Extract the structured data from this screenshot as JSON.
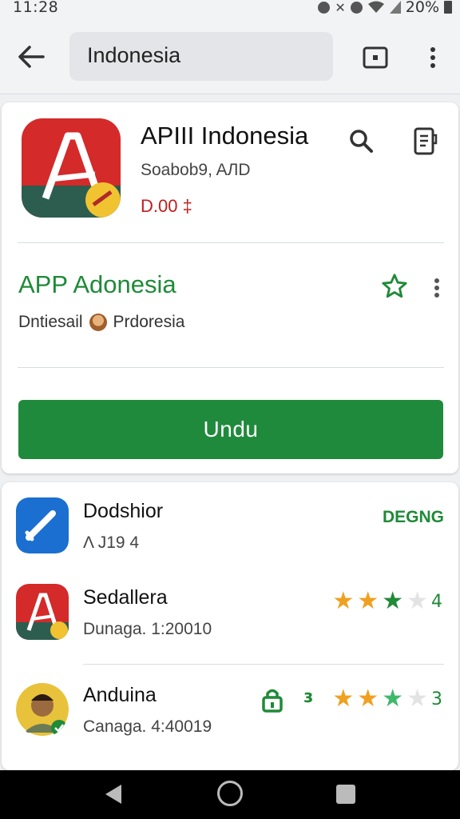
{
  "status_bar": {
    "time": "11:28",
    "battery_text": "20%"
  },
  "top_bar": {
    "search_value": "Indonesia"
  },
  "app_card": {
    "title": "APIII Indonesia",
    "subtitle": "Soabob9, AЛD",
    "price": "D.00 ‡",
    "name_green": "APP Adonesia",
    "developer_left": "Dntiesail",
    "developer_right": "Prdoresia",
    "install_label": "Undu",
    "accent_color": "#208a3c"
  },
  "list": [
    {
      "name": "Dodshior",
      "meta": "Λ J19 4",
      "action_label": "DEGNG",
      "icon": "pencil-app-icon"
    },
    {
      "name": "Sedallera",
      "meta": "Dunaga. 1:20010",
      "rating_value": "4",
      "stars": [
        1,
        1,
        1,
        0
      ],
      "icon": "red-a-app-icon"
    },
    {
      "name": "Anduina",
      "meta": "Canaga. 4:40019",
      "rating_value": "3",
      "tick": "ɜ",
      "stars": [
        1,
        1,
        0.5,
        0
      ],
      "icon": "person-app-icon"
    }
  ]
}
